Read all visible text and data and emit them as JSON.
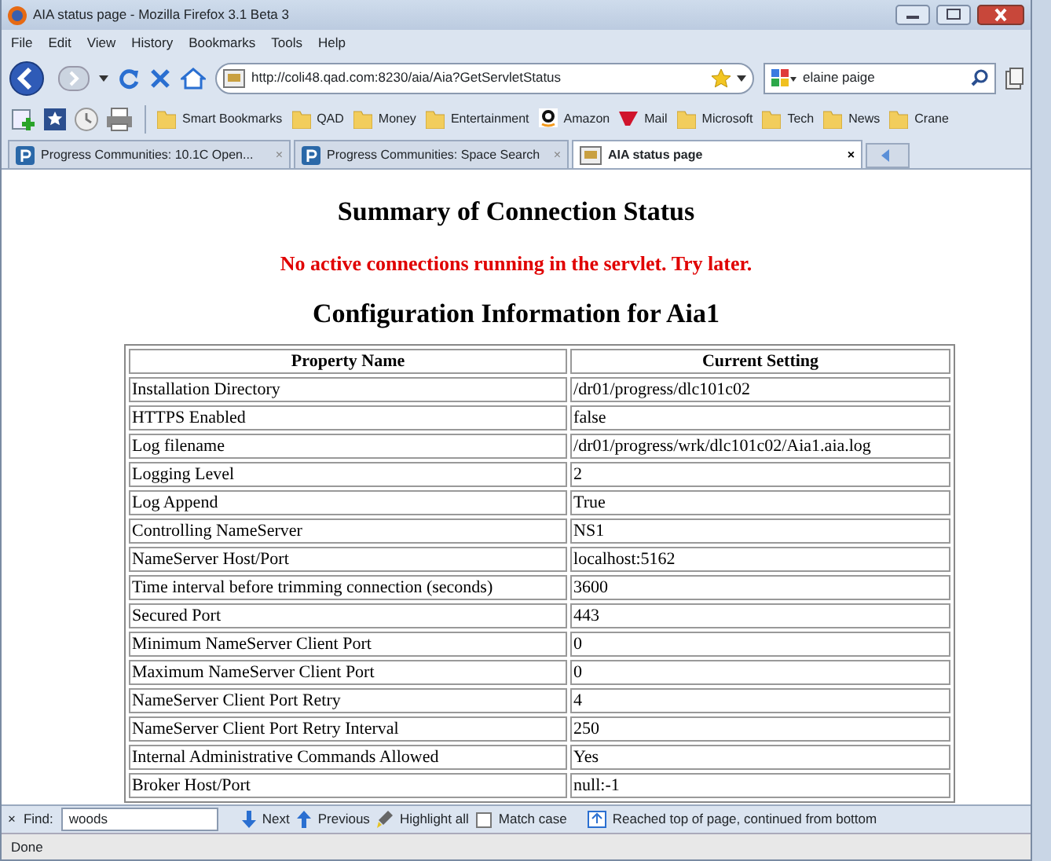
{
  "window": {
    "title": "AIA status page - Mozilla Firefox 3.1 Beta 3"
  },
  "menu": [
    "File",
    "Edit",
    "View",
    "History",
    "Bookmarks",
    "Tools",
    "Help"
  ],
  "navigation": {
    "url": "http://coli48.qad.com:8230/aia/Aia?GetServletStatus",
    "search": {
      "value": "elaine paige"
    }
  },
  "bookmarks": [
    {
      "label": "Smart Bookmarks",
      "kind": "folder"
    },
    {
      "label": "QAD",
      "kind": "folder"
    },
    {
      "label": "Money",
      "kind": "folder"
    },
    {
      "label": "Entertainment",
      "kind": "folder"
    },
    {
      "label": "Amazon",
      "kind": "amazon"
    },
    {
      "label": "Mail",
      "kind": "mail"
    },
    {
      "label": "Microsoft",
      "kind": "folder"
    },
    {
      "label": "Tech",
      "kind": "folder"
    },
    {
      "label": "News",
      "kind": "folder"
    },
    {
      "label": "Crane",
      "kind": "folder"
    }
  ],
  "tabs": [
    {
      "label": "Progress Communities: 10.1C Open...",
      "close": "×",
      "selected": false,
      "kind": "site"
    },
    {
      "label": "Progress Communities: Space Search",
      "close": "×",
      "selected": false,
      "kind": "site"
    },
    {
      "label": "AIA status page",
      "close": "×",
      "selected": true,
      "kind": "page"
    }
  ],
  "page": {
    "heading": "Summary of Connection Status",
    "warning": "No active connections running in the servlet. Try later.",
    "subheading": "Configuration Information for Aia1",
    "table": {
      "columns": [
        "Property Name",
        "Current Setting"
      ],
      "rows": [
        [
          "Installation Directory",
          "/dr01/progress/dlc101c02"
        ],
        [
          "HTTPS Enabled",
          "false"
        ],
        [
          "Log filename",
          "/dr01/progress/wrk/dlc101c02/Aia1.aia.log"
        ],
        [
          "Logging Level",
          "2"
        ],
        [
          "Log Append",
          "True"
        ],
        [
          "Controlling NameServer",
          "NS1"
        ],
        [
          "NameServer Host/Port",
          "localhost:5162"
        ],
        [
          "Time interval before trimming connection (seconds)",
          "3600"
        ],
        [
          "Secured Port",
          "443"
        ],
        [
          "Minimum NameServer Client Port",
          "0"
        ],
        [
          "Maximum NameServer Client Port",
          "0"
        ],
        [
          "NameServer Client Port Retry",
          "4"
        ],
        [
          "NameServer Client Port Retry Interval",
          "250"
        ],
        [
          "Internal Administrative Commands Allowed",
          "Yes"
        ],
        [
          "Broker Host/Port",
          "null:-1"
        ]
      ]
    }
  },
  "find_bar": {
    "close": "×",
    "label": "Find:",
    "value": "woods",
    "next": "Next",
    "previous": "Previous",
    "highlight": "Highlight all",
    "match_case": {
      "label": "Match case",
      "checked": false
    },
    "message": "Reached top of page, continued from bottom"
  },
  "status_bar": "Done"
}
